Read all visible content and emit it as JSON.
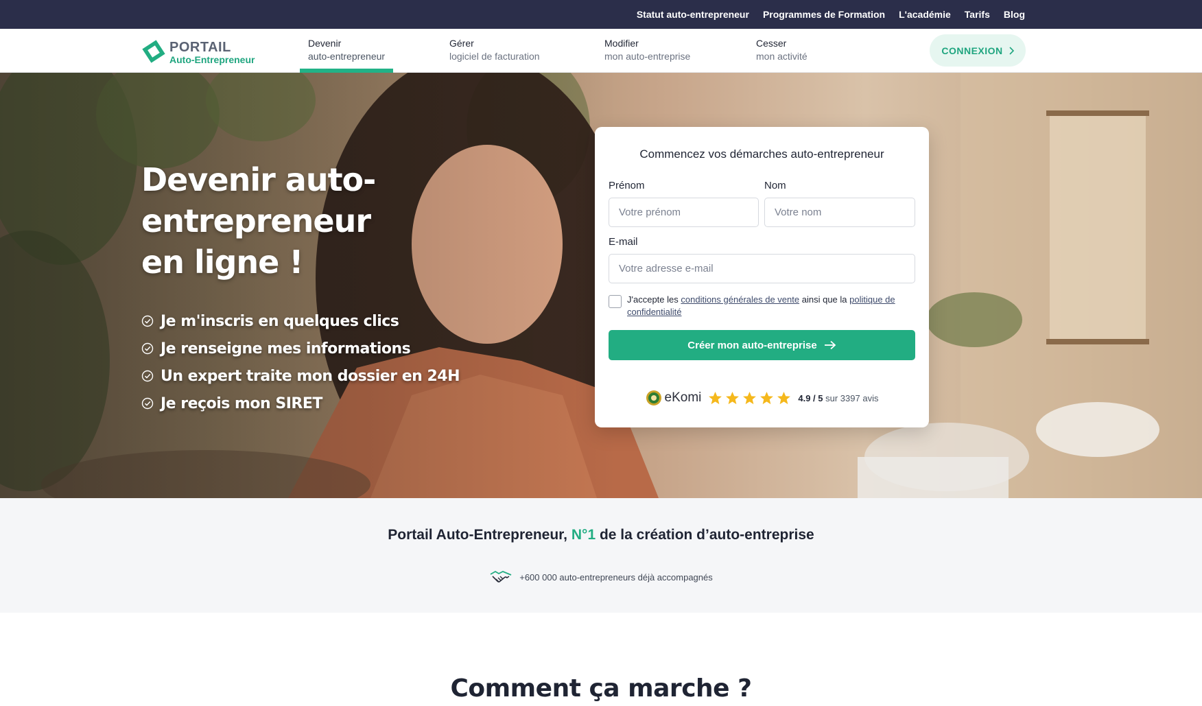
{
  "topbar": {
    "links": [
      "Statut auto-entrepreneur",
      "Programmes de Formation",
      "L'académie",
      "Tarifs",
      "Blog"
    ]
  },
  "brand": {
    "name_line1": "PORTAIL",
    "name_line2": "Auto-Entrepreneur",
    "accent_color": "#22ad82",
    "dark_color": "#2b2e4a"
  },
  "nav": {
    "items": [
      {
        "line1": "Devenir",
        "line2": "auto-entrepreneur",
        "active": true
      },
      {
        "line1": "Gérer",
        "line2": "logiciel de facturation",
        "active": false
      },
      {
        "line1": "Modifier",
        "line2": "mon auto-entreprise",
        "active": false
      },
      {
        "line1": "Cesser",
        "line2": "mon activité",
        "active": false
      }
    ],
    "login_label": "CONNEXION",
    "login_icon": "chevron-right-icon"
  },
  "hero": {
    "title_line1": "Devenir auto-",
    "title_line2": "entrepreneur",
    "title_line3": "en ligne !",
    "bullets": [
      "Je m'inscris en quelques clics",
      "Je renseigne mes informations",
      "Un expert traite mon dossier en 24H",
      "Je reçois mon SIRET"
    ],
    "bullet_icon": "check-circle-icon"
  },
  "form": {
    "title": "Commencez vos démarches auto-entrepreneur",
    "firstname_label": "Prénom",
    "firstname_placeholder": "Votre prénom",
    "firstname_value": "",
    "lastname_label": "Nom",
    "lastname_placeholder": "Votre nom",
    "lastname_value": "",
    "email_label": "E-mail",
    "email_placeholder": "Votre adresse e-mail",
    "email_value": "",
    "consent_prefix": "J'accepte les",
    "consent_link1": "conditions générales de vente",
    "consent_middle": "ainsi que la",
    "consent_link2": "politique de confidentialité",
    "consent_checked": false,
    "submit_label": "Créer mon auto-entreprise",
    "submit_icon": "arrow-right-icon"
  },
  "rating": {
    "provider": "eKomi",
    "stars": 5,
    "score": "4.9 / 5",
    "count_text": "sur 3397 avis"
  },
  "trust": {
    "title_prefix": "Portail Auto-Entrepreneur,",
    "title_accent": "N°1",
    "title_suffix": "de la création d’auto-entreprise",
    "subtitle": "+600 000 auto-entrepreneurs déjà accompagnés",
    "icon": "handshake-icon"
  },
  "how": {
    "title": "Comment ça marche ?"
  }
}
